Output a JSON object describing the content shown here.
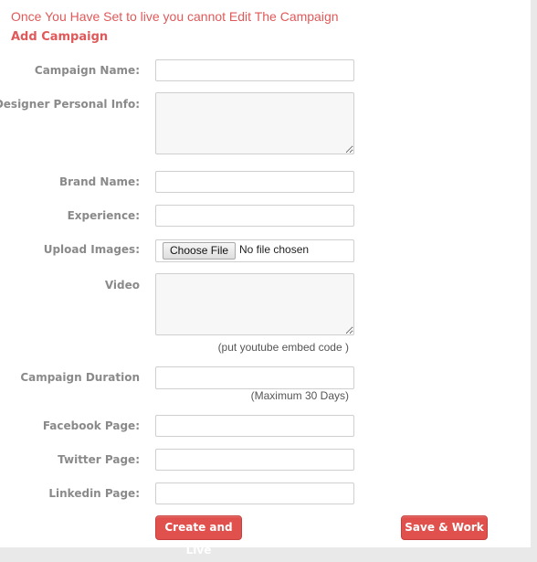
{
  "notice": "Once You Have Set to live you cannot Edit The Campaign",
  "heading": "Add Campaign",
  "form": {
    "campaign_name": {
      "label": "Campaign Name:",
      "value": ""
    },
    "designer_info": {
      "label": "Designer Personal Info:",
      "value": ""
    },
    "brand_name": {
      "label": "Brand Name:",
      "value": ""
    },
    "experience": {
      "label": "Experience:",
      "value": ""
    },
    "upload_images": {
      "label": "Upload Images:",
      "button": "Choose File",
      "status": "No file chosen"
    },
    "video": {
      "label": "Video",
      "value": "",
      "hint": "(put youtube embed code )"
    },
    "duration": {
      "label": "Campaign Duration",
      "value": "",
      "hint": "(Maximum 30 Days)"
    },
    "facebook": {
      "label": "Facebook Page:",
      "value": ""
    },
    "twitter": {
      "label": "Twitter Page:",
      "value": ""
    },
    "linkedin": {
      "label": "Linkedin Page:",
      "value": ""
    }
  },
  "buttons": {
    "create_live": "Create and Live",
    "save_work": "Save & Work"
  },
  "colors": {
    "accent": "#e0595a",
    "button": "#e0504c",
    "label": "#8a8a8a"
  }
}
